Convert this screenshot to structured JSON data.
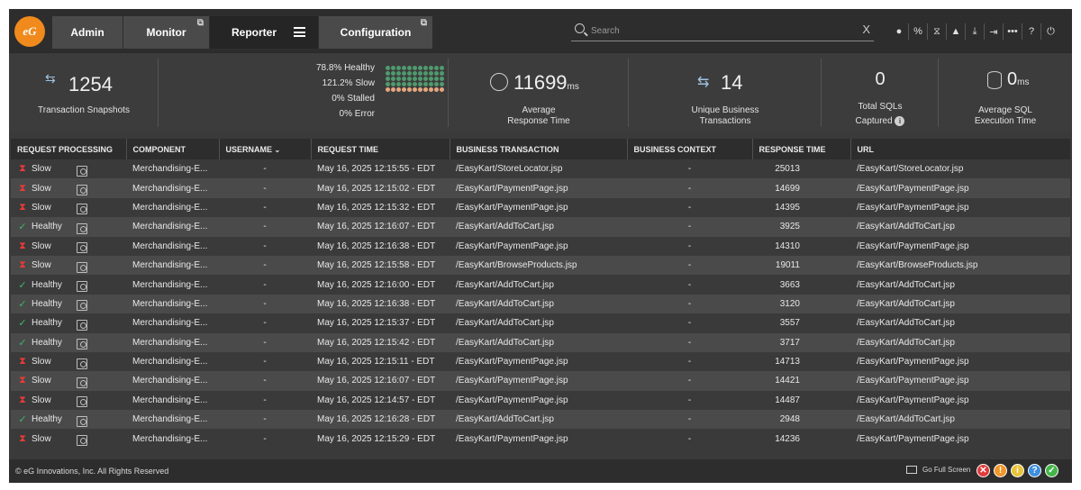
{
  "logo": {
    "text": "eG"
  },
  "nav": {
    "tabs": [
      {
        "label": "Admin"
      },
      {
        "label": "Monitor"
      },
      {
        "label": "Reporter"
      },
      {
        "label": "Configuration"
      }
    ],
    "search_placeholder": "Search",
    "clear_label": "X"
  },
  "summary": {
    "snapshots": {
      "value": "1254",
      "label": "Transaction Snapshots"
    },
    "health": {
      "healthy": "78.8%  Healthy",
      "slow": "121.2%  Slow",
      "stalled": "0%  Stalled",
      "error": "0%  Error",
      "healthy_dots": 44,
      "slow_dots": 11
    },
    "response": {
      "value": "11699",
      "unit": "ms",
      "label1": "Average",
      "label2": "Response Time"
    },
    "unique": {
      "value": "14",
      "label1": "Unique Business",
      "label2": "Transactions"
    },
    "sqls": {
      "value": "0",
      "label1": "Total SQLs",
      "label2": "Captured"
    },
    "sql_time": {
      "value": "0",
      "unit": "ms",
      "label1": "Average SQL",
      "label2": "Execution Time"
    }
  },
  "table": {
    "headers": [
      "REQUEST PROCESSING",
      "COMPONENT",
      "USERNAME",
      "REQUEST TIME",
      "BUSINESS TRANSACTION",
      "BUSINESS CONTEXT",
      "RESPONSE TIME",
      "URL"
    ],
    "rows": [
      {
        "status": "Slow",
        "component": "Merchandising-E...",
        "username": "-",
        "time": "May 16, 2025 12:15:55 - EDT",
        "bt": "/EasyKart/StoreLocator.jsp",
        "ctx": "-",
        "rt": "25013",
        "url": "/EasyKart/StoreLocator.jsp"
      },
      {
        "status": "Slow",
        "component": "Merchandising-E...",
        "username": "-",
        "time": "May 16, 2025 12:15:02 - EDT",
        "bt": "/EasyKart/PaymentPage.jsp",
        "ctx": "-",
        "rt": "14699",
        "url": "/EasyKart/PaymentPage.jsp"
      },
      {
        "status": "Slow",
        "component": "Merchandising-E...",
        "username": "-",
        "time": "May 16, 2025 12:15:32 - EDT",
        "bt": "/EasyKart/PaymentPage.jsp",
        "ctx": "-",
        "rt": "14395",
        "url": "/EasyKart/PaymentPage.jsp"
      },
      {
        "status": "Healthy",
        "component": "Merchandising-E...",
        "username": "-",
        "time": "May 16, 2025 12:16:07 - EDT",
        "bt": "/EasyKart/AddToCart.jsp",
        "ctx": "-",
        "rt": "3925",
        "url": "/EasyKart/AddToCart.jsp"
      },
      {
        "status": "Slow",
        "component": "Merchandising-E...",
        "username": "-",
        "time": "May 16, 2025 12:16:38 - EDT",
        "bt": "/EasyKart/PaymentPage.jsp",
        "ctx": "-",
        "rt": "14310",
        "url": "/EasyKart/PaymentPage.jsp"
      },
      {
        "status": "Slow",
        "component": "Merchandising-E...",
        "username": "-",
        "time": "May 16, 2025 12:15:58 - EDT",
        "bt": "/EasyKart/BrowseProducts.jsp",
        "ctx": "-",
        "rt": "19011",
        "url": "/EasyKart/BrowseProducts.jsp"
      },
      {
        "status": "Healthy",
        "component": "Merchandising-E...",
        "username": "-",
        "time": "May 16, 2025 12:16:00 - EDT",
        "bt": "/EasyKart/AddToCart.jsp",
        "ctx": "-",
        "rt": "3663",
        "url": "/EasyKart/AddToCart.jsp"
      },
      {
        "status": "Healthy",
        "component": "Merchandising-E...",
        "username": "-",
        "time": "May 16, 2025 12:16:38 - EDT",
        "bt": "/EasyKart/AddToCart.jsp",
        "ctx": "-",
        "rt": "3120",
        "url": "/EasyKart/AddToCart.jsp"
      },
      {
        "status": "Healthy",
        "component": "Merchandising-E...",
        "username": "-",
        "time": "May 16, 2025 12:15:37 - EDT",
        "bt": "/EasyKart/AddToCart.jsp",
        "ctx": "-",
        "rt": "3557",
        "url": "/EasyKart/AddToCart.jsp"
      },
      {
        "status": "Healthy",
        "component": "Merchandising-E...",
        "username": "-",
        "time": "May 16, 2025 12:15:42 - EDT",
        "bt": "/EasyKart/AddToCart.jsp",
        "ctx": "-",
        "rt": "3717",
        "url": "/EasyKart/AddToCart.jsp"
      },
      {
        "status": "Slow",
        "component": "Merchandising-E...",
        "username": "-",
        "time": "May 16, 2025 12:15:11 - EDT",
        "bt": "/EasyKart/PaymentPage.jsp",
        "ctx": "-",
        "rt": "14713",
        "url": "/EasyKart/PaymentPage.jsp"
      },
      {
        "status": "Slow",
        "component": "Merchandising-E...",
        "username": "-",
        "time": "May 16, 2025 12:16:07 - EDT",
        "bt": "/EasyKart/PaymentPage.jsp",
        "ctx": "-",
        "rt": "14421",
        "url": "/EasyKart/PaymentPage.jsp"
      },
      {
        "status": "Slow",
        "component": "Merchandising-E...",
        "username": "-",
        "time": "May 16, 2025 12:14:57 - EDT",
        "bt": "/EasyKart/PaymentPage.jsp",
        "ctx": "-",
        "rt": "14487",
        "url": "/EasyKart/PaymentPage.jsp"
      },
      {
        "status": "Healthy",
        "component": "Merchandising-E...",
        "username": "-",
        "time": "May 16, 2025 12:16:28 - EDT",
        "bt": "/EasyKart/AddToCart.jsp",
        "ctx": "-",
        "rt": "2948",
        "url": "/EasyKart/AddToCart.jsp"
      },
      {
        "status": "Slow",
        "component": "Merchandising-E...",
        "username": "-",
        "time": "May 16, 2025 12:15:29 - EDT",
        "bt": "/EasyKart/PaymentPage.jsp",
        "ctx": "-",
        "rt": "14236",
        "url": "/EasyKart/PaymentPage.jsp"
      }
    ]
  },
  "footer": {
    "copyright": "© eG Innovations, Inc. All Rights Reserved",
    "fullscreen": "Go Full Screen",
    "status_dots": [
      {
        "name": "critical-status-icon",
        "glyph": "✕",
        "color": "#e03b3b"
      },
      {
        "name": "major-status-icon",
        "glyph": "!",
        "color": "#f0962a"
      },
      {
        "name": "minor-status-icon",
        "glyph": "i",
        "color": "#e8c23a"
      },
      {
        "name": "unknown-status-icon",
        "glyph": "?",
        "color": "#3d8fe0"
      },
      {
        "name": "normal-status-icon",
        "glyph": "✓",
        "color": "#45b649"
      }
    ]
  },
  "colors": {
    "slow": "#e63a3a",
    "healthy": "#3fb56b",
    "accent": "#f08a1c"
  }
}
